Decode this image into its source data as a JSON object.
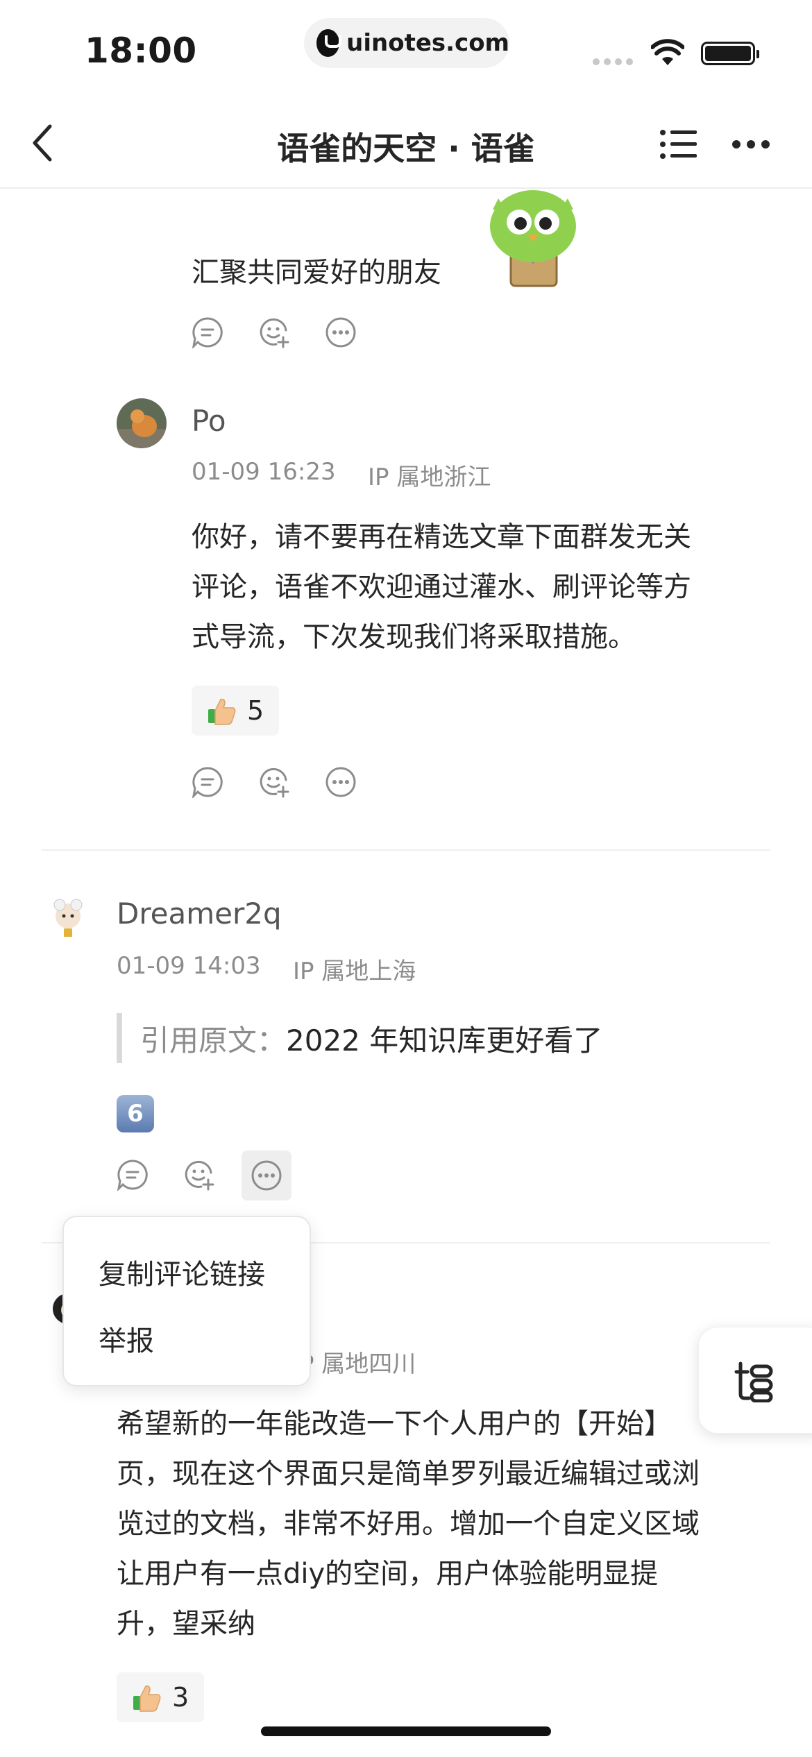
{
  "status_bar": {
    "time": "18:00",
    "url": "uinotes.com"
  },
  "nav": {
    "title": "语雀的天空 · 语雀",
    "icons": [
      "back-chevron-icon",
      "table-of-contents-icon",
      "more-dots-icon"
    ]
  },
  "top_comment": {
    "text": "汇聚共同爱好的朋友"
  },
  "reply_po": {
    "author": "Po",
    "date": "01-09 16:23",
    "ip": "IP 属地浙江",
    "lines": [
      "你好，请不要再在精选文章下面群发无关",
      "评论，语雀不欢迎通过灌水、刷评论等方",
      "式导流，下次发现我们将采取措施。"
    ],
    "reaction_count": "5"
  },
  "comment_dreamer": {
    "author": "Dreamer2q",
    "date": "01-09 14:03",
    "ip": "IP 属地上海",
    "quote_label": "引用原文：",
    "quote_text": "2022 年知识库更好看了",
    "emoji_digit": "6"
  },
  "comment_three": {
    "ip_partial": "P 属地四川",
    "lines": [
      "希望新的一年能改造一下个人用户的【开始】",
      "页，现在这个界面只是简单罗列最近编辑过或浏",
      "览过的文档，非常不好用。增加一个自定义区域",
      "让用户有一点diy的空间，用户体验能明显提",
      "升，望采纳"
    ],
    "reaction_count": "3"
  },
  "popup_menu": {
    "copy_link": "复制评论链接",
    "report": "举报"
  },
  "colors": {
    "text": "#262626",
    "meta": "#8c8c8c",
    "reaction_bg": "#f5f5f5"
  }
}
